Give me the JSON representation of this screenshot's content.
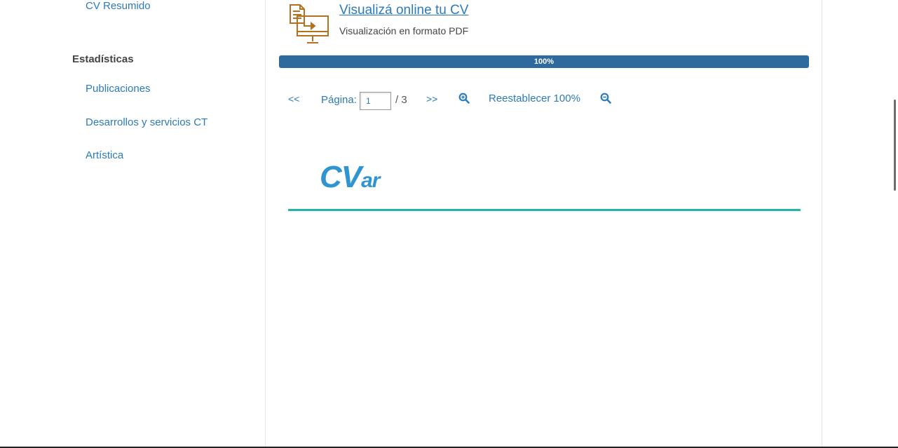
{
  "sidebar": {
    "cv_resumido": "CV Resumido",
    "stats_heading": "Estadísticas",
    "items": [
      {
        "label": "Publicaciones"
      },
      {
        "label": "Desarrollos y servicios CT"
      },
      {
        "label": "Artística"
      }
    ]
  },
  "viewer": {
    "title": "Visualizá online tu CV",
    "subtitle": "Visualización en formato PDF",
    "icon": "pdf-monitor-icon",
    "progress": {
      "label": "100%",
      "value": 100
    },
    "pager": {
      "prev": "<<",
      "next": ">>",
      "page_label": "Página:",
      "page_value": "1",
      "of_pages": "/ 3",
      "reset_zoom": "Reestablecer 100%",
      "zoom_in_icon": "zoom-in-icon",
      "zoom_out_icon": "zoom-out-icon"
    },
    "document": {
      "logo_big": "CV",
      "logo_small": "ar"
    }
  },
  "colors": {
    "link": "#2b7bb9",
    "progress": "#2f6a9e",
    "accent_line": "#26b3a8",
    "logo": "#2f95d0",
    "icon": "#b5711f"
  }
}
